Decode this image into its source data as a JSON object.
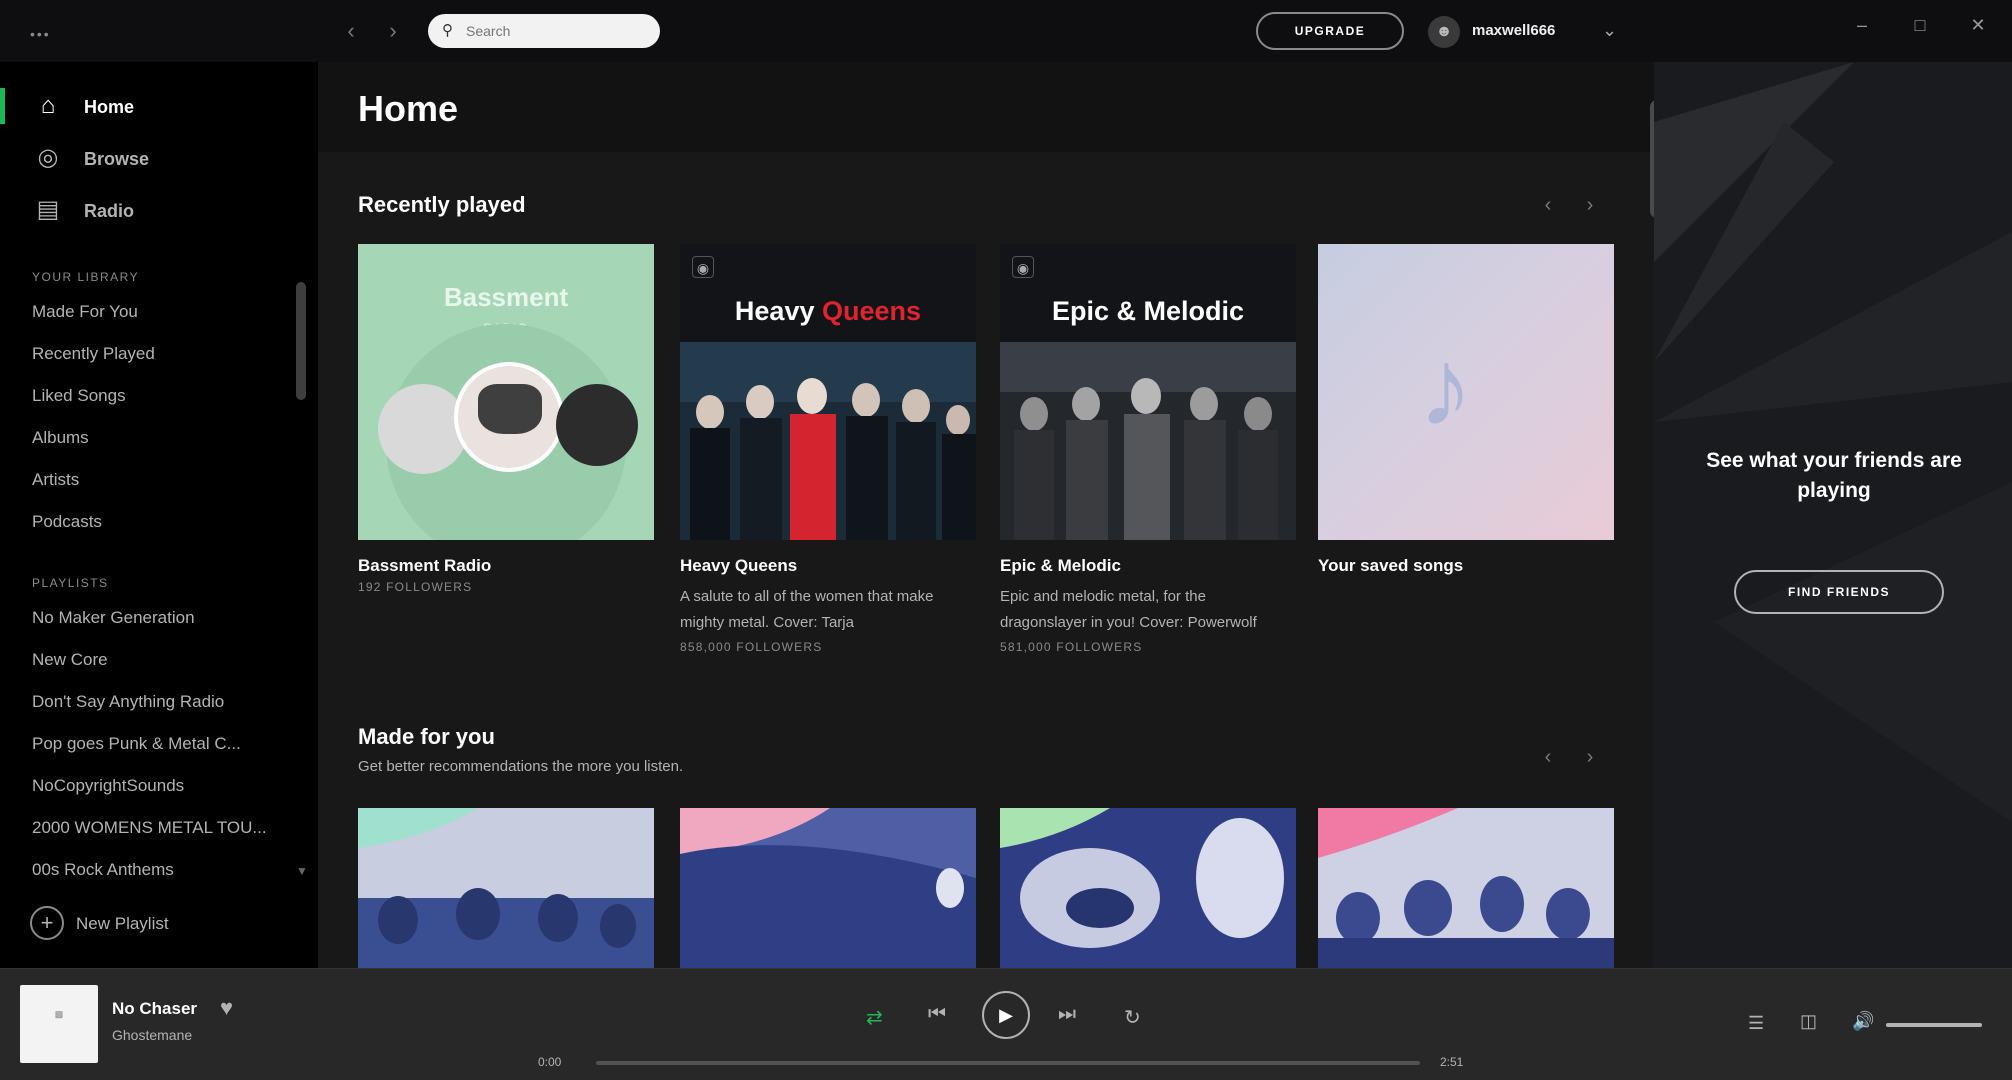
{
  "top_bar": {
    "app_menu": "•••",
    "search_placeholder": "Search",
    "upgrade_label": "UPGRADE",
    "username": "maxwell666",
    "icons": [
      "back-arrow-icon",
      "forward-arrow-icon",
      "search-icon",
      "user-icon",
      "chevron-down-icon",
      "minimize-icon",
      "maximize-icon",
      "close-icon"
    ]
  },
  "sidebar": {
    "nav": [
      {
        "label": "Home",
        "icon": "home-icon",
        "active": true
      },
      {
        "label": "Browse",
        "icon": "browse-icon",
        "active": false
      },
      {
        "label": "Radio",
        "icon": "radio-icon",
        "active": false
      }
    ],
    "library_header": "YOUR LIBRARY",
    "library": [
      "Made For You",
      "Recently Played",
      "Liked Songs",
      "Albums",
      "Artists",
      "Podcasts"
    ],
    "playlists_header": "PLAYLISTS",
    "playlists": [
      "No Maker Generation",
      "New Core",
      "Don't Say Anything Radio",
      "Pop goes Punk & Metal C...",
      "NoCopyrightSounds",
      "2000 WOMENS METAL TOU...",
      "00s Rock Anthems"
    ],
    "new_playlist_label": "New Playlist"
  },
  "main": {
    "title": "Home",
    "recently_played": {
      "title": "Recently played",
      "cards": [
        {
          "title": "Bassment Radio",
          "desc": "",
          "followers": "192 FOLLOWERS",
          "art_word": "Bassment",
          "art_sub": "RADIO"
        },
        {
          "title": "Heavy Queens",
          "desc": "A salute to all of the women that make mighty metal. Cover: Tarja",
          "followers": "858,000 FOLLOWERS",
          "art_word_1": "Heavy",
          "art_word_2": "Queens"
        },
        {
          "title": "Epic & Melodic",
          "desc": "Epic and melodic metal, for the dragonslayer in you! Cover: Powerwolf",
          "followers": "581,000 FOLLOWERS",
          "art_word": "Epic & Melodic"
        },
        {
          "title": "Your saved songs",
          "desc": "",
          "followers": ""
        }
      ]
    },
    "made_for_you": {
      "title": "Made for you",
      "subtitle": "Get better recommendations the more you listen."
    }
  },
  "friends_panel": {
    "text": "See what your friends are playing",
    "button_label": "FIND FRIENDS"
  },
  "player": {
    "track_title": "No Chaser",
    "artist": "Ghostemane",
    "time_elapsed": "0:00",
    "time_total": "2:51",
    "progress": 0.0,
    "volume": 1.0,
    "shuffle_active": true,
    "accent": "#1db954"
  },
  "colors": {
    "accent": "#1db954",
    "background": "#121212",
    "sidebar": "#000000",
    "player_bar": "#282828",
    "heavy_queens_red": "#e0242f"
  }
}
